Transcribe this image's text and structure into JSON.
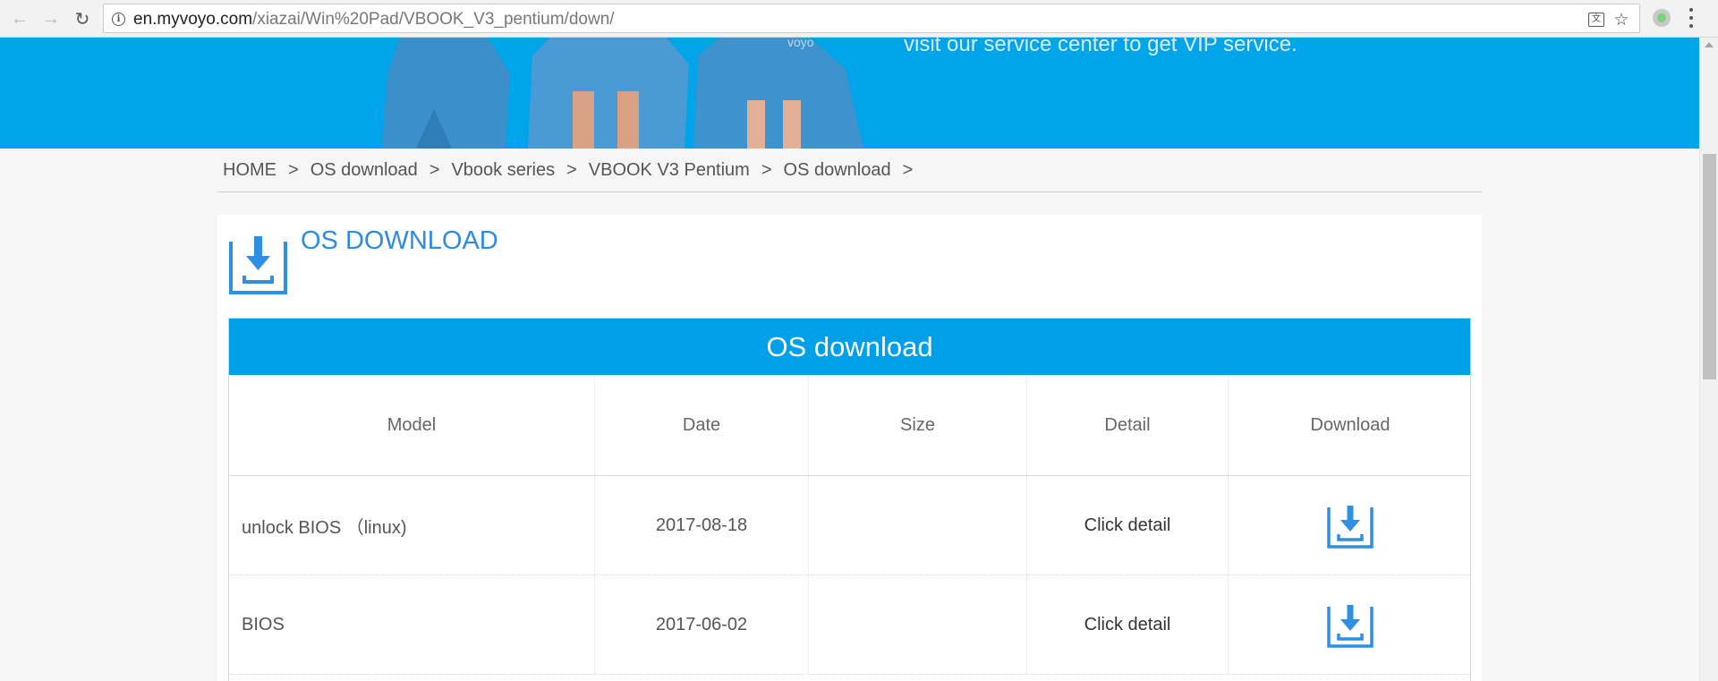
{
  "browser": {
    "url_host": "en.myvoyo.com",
    "url_path": "/xiazai/Win%20Pad/VBOOK_V3_pentium/down/",
    "back_icon": "back-arrow-icon",
    "forward_icon": "forward-arrow-icon",
    "reload_icon": "reload-icon"
  },
  "banner": {
    "text": "visit our service center to get VIP service."
  },
  "breadcrumb": {
    "items": [
      "HOME",
      "OS download",
      "Vbook series",
      "VBOOK V3 Pentium",
      "OS download"
    ],
    "separator": ">"
  },
  "section": {
    "title": "OS DOWNLOAD"
  },
  "table": {
    "title": "OS download",
    "columns": [
      "Model",
      "Date",
      "Size",
      "Detail",
      "Download"
    ],
    "rows": [
      {
        "model": "unlock BIOS （linux)",
        "date": "2017-08-18",
        "size": "",
        "detail": "Click detail"
      },
      {
        "model": "BIOS",
        "date": "2017-06-02",
        "size": "",
        "detail": "Click detail"
      }
    ]
  },
  "colors": {
    "accent": "#00a0e9",
    "title": "#2d8ce0",
    "icon_blue": "#2e8fe3"
  }
}
